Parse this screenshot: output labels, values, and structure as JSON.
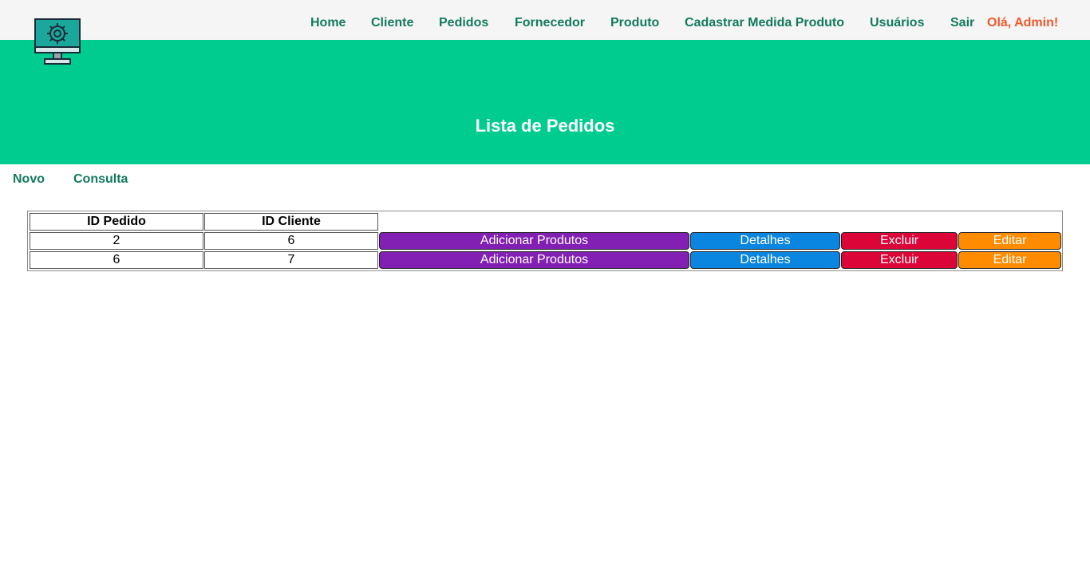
{
  "nav": {
    "items": [
      "Home",
      "Cliente",
      "Pedidos",
      "Fornecedor",
      "Produto",
      "Cadastrar Medida Produto",
      "Usuários",
      "Sair"
    ],
    "greeting": "Olá, Admin!"
  },
  "logo": {
    "icon": "computer-settings-icon"
  },
  "hero": {
    "title": "Lista de Pedidos"
  },
  "subnav": {
    "items": [
      "Novo",
      "Consulta"
    ]
  },
  "table": {
    "headers": [
      "ID Pedido",
      "ID Cliente"
    ],
    "rows": [
      {
        "id_pedido": "2",
        "id_cliente": "6",
        "actions": [
          "Adicionar Produtos",
          "Detalhes",
          "Excluir",
          "Editar"
        ]
      },
      {
        "id_pedido": "6",
        "id_cliente": "7",
        "actions": [
          "Adicionar Produtos",
          "Detalhes",
          "Excluir",
          "Editar"
        ]
      }
    ]
  },
  "colors": {
    "topbar": "#f5f5f5",
    "hero": "#00cc90",
    "nav_text": "#137a5e",
    "greeting": "#f0582b",
    "add_button": "#8120b3",
    "details_button": "#0b86e0",
    "delete_button": "#db0538",
    "edit_button": "#ff8c00"
  }
}
